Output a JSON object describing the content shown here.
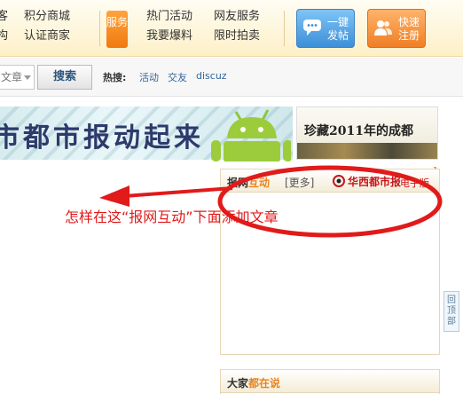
{
  "nav": {
    "col1": [
      "客",
      "构"
    ],
    "col2": [
      "积分商城",
      "认证商家"
    ],
    "service_badge": "服务",
    "col3": [
      "热门活动",
      "我要爆料"
    ],
    "col4": [
      "网友服务",
      "限时拍卖"
    ],
    "post_button": "一键发帖",
    "register_button": "快速注册"
  },
  "search": {
    "type_value": "文章",
    "button": "搜索",
    "hot_label": "热搜:",
    "hot_links": [
      "活动",
      "交友",
      "discuz"
    ]
  },
  "banner": {
    "slogan": "市都市报动起来",
    "side_caption": "珍藏2011年的成都"
  },
  "panel_news": {
    "title_a": "报网",
    "title_b": "互动",
    "more": "[更多]",
    "newspaper_logo": "华西都市报",
    "edition": "电子版"
  },
  "panel_talk": {
    "title_a": "大家",
    "title_b": "都在说"
  },
  "back_to_top": "回顶部",
  "annotation": {
    "text": "怎样在这“报网互动”下面添加文章",
    "color": "#e11a1a"
  },
  "colors": {
    "accent_orange": "#e8841f",
    "link_blue": "#336699",
    "post_blue": "#3d8fd8",
    "register_orange": "#f07f25"
  }
}
